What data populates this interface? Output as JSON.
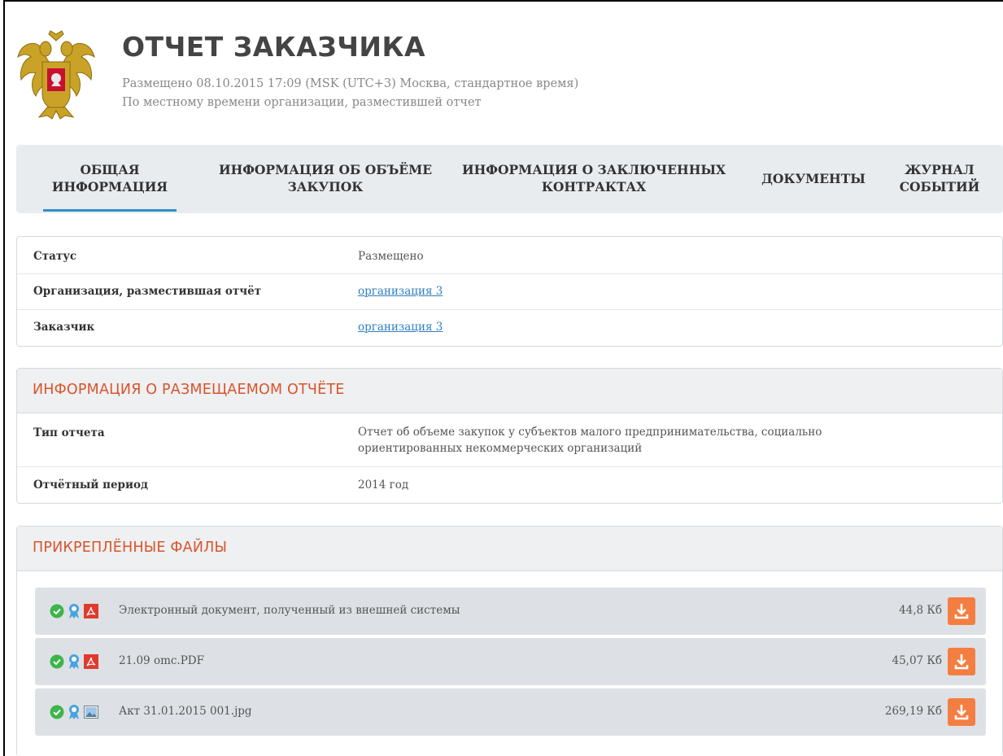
{
  "header": {
    "title": "ОТЧЕТ ЗАКАЗЧИКА",
    "posted": "Размещено 08.10.2015 17:09 (MSK (UTC+3) Москва, стандартное время)",
    "timezone_note": "По местному времени организации, разместившей отчет"
  },
  "tabs": [
    {
      "label": "ОБЩАЯ\nИНФОРМАЦИЯ",
      "active": true
    },
    {
      "label": "ИНФОРМАЦИЯ ОБ ОБЪЁМЕ\nЗАКУПОК",
      "active": false
    },
    {
      "label": "ИНФОРМАЦИЯ О ЗАКЛЮЧЕННЫХ\nКОНТРАКТАХ",
      "active": false
    },
    {
      "label": "ДОКУМЕНТЫ",
      "active": false
    },
    {
      "label": "ЖУРНАЛ\nСОБЫТИЙ",
      "active": false
    }
  ],
  "general": {
    "status_label": "Статус",
    "status_value": "Размещено",
    "org_label": "Организация, разместившая отчёт",
    "org_value": "организация 3",
    "customer_label": "Заказчик",
    "customer_value": "организация 3"
  },
  "report_info": {
    "title": "ИНФОРМАЦИЯ О РАЗМЕЩАЕМОМ ОТЧЁТЕ",
    "type_label": "Тип отчета",
    "type_value_line1": "Отчет об объеме закупок у субъектов малого предпринимательства, социально",
    "type_value_line2": "ориентированных некоммерческих организаций",
    "period_label": "Отчётный период",
    "period_value": "2014 год"
  },
  "files": {
    "title": "ПРИКРЕПЛЁННЫЕ ФАЙЛЫ",
    "items": [
      {
        "name": "Электронный документ, полученный из внешней системы",
        "size": "44,8 Кб",
        "type_icon": "pdf-icon"
      },
      {
        "name": "21.09 omc.PDF",
        "size": "45,07 Кб",
        "type_icon": "pdf-icon"
      },
      {
        "name": "Акт 31.01.2015 001.jpg",
        "size": "269,19 Кб",
        "type_icon": "image-icon"
      }
    ]
  },
  "colors": {
    "accent_orange": "#d9542b",
    "download_button": "#f47e41",
    "link_blue": "#2f7fc1",
    "tab_active_underline": "#2f8fce",
    "check_green": "#3cb54a"
  }
}
